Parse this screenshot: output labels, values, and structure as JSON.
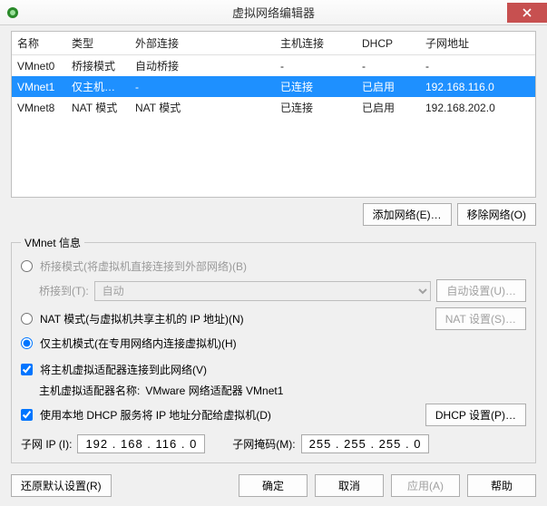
{
  "window": {
    "title": "虚拟网络编辑器"
  },
  "table": {
    "headers": [
      "名称",
      "类型",
      "外部连接",
      "主机连接",
      "DHCP",
      "子网地址"
    ],
    "rows": [
      {
        "cells": [
          "VMnet0",
          "桥接模式",
          "自动桥接",
          "-",
          "-",
          "-"
        ],
        "selected": false
      },
      {
        "cells": [
          "VMnet1",
          "仅主机…",
          "-",
          "已连接",
          "已启用",
          "192.168.116.0"
        ],
        "selected": true
      },
      {
        "cells": [
          "VMnet8",
          "NAT 模式",
          "NAT 模式",
          "已连接",
          "已启用",
          "192.168.202.0"
        ],
        "selected": false
      }
    ]
  },
  "buttons": {
    "add_net": "添加网络(E)…",
    "remove_net": "移除网络(O)",
    "auto_set": "自动设置(U)…",
    "nat_set": "NAT 设置(S)…",
    "dhcp_set": "DHCP 设置(P)…",
    "restore": "还原默认设置(R)",
    "ok": "确定",
    "cancel": "取消",
    "apply": "应用(A)",
    "help": "帮助"
  },
  "info": {
    "legend": "VMnet 信息",
    "bridge_label": "桥接模式(将虚拟机直接连接到外部网络)(B)",
    "bridge_to": "桥接到(T):",
    "bridge_select": "自动",
    "nat_label": "NAT 模式(与虚拟机共享主机的 IP 地址)(N)",
    "host_label": "仅主机模式(在专用网络内连接虚拟机)(H)",
    "connect_host": "将主机虚拟适配器连接到此网络(V)",
    "host_adapter_label": "主机虚拟适配器名称:",
    "host_adapter_value": "VMware 网络适配器 VMnet1",
    "use_dhcp": "使用本地 DHCP 服务将 IP 地址分配给虚拟机(D)",
    "subnet_ip_label": "子网 IP (I):",
    "subnet_ip": "192 . 168 . 116 . 0",
    "subnet_mask_label": "子网掩码(M):",
    "subnet_mask": "255 . 255 . 255 . 0"
  }
}
